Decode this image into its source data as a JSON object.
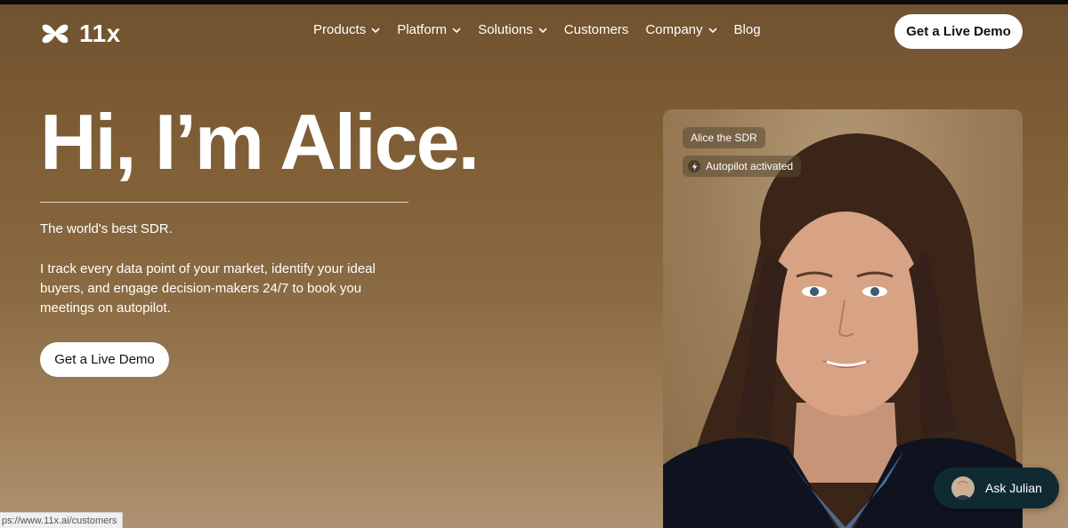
{
  "header": {
    "logo_text": "11x",
    "nav": [
      {
        "label": "Products",
        "has_dropdown": true
      },
      {
        "label": "Platform",
        "has_dropdown": true
      },
      {
        "label": "Solutions",
        "has_dropdown": true
      },
      {
        "label": "Customers",
        "has_dropdown": false
      },
      {
        "label": "Company",
        "has_dropdown": true
      },
      {
        "label": "Blog",
        "has_dropdown": false
      }
    ],
    "cta_label": "Get a Live Demo"
  },
  "hero": {
    "title": "Hi, I’m Alice.",
    "tagline": "The world's best SDR.",
    "description": "I track every data point of your market, identify your ideal buyers, and engage decision-makers 24/7 to book you meetings on autopilot.",
    "cta_label": "Get a Live Demo"
  },
  "card": {
    "name_badge": "Alice the SDR",
    "status_badge": "Autopilot activated",
    "status_icon": "lightning-icon"
  },
  "chat_widget": {
    "label": "Ask Julian",
    "icon": "avatar"
  },
  "status_bar": {
    "url": "ps://www.11x.ai/customers"
  },
  "colors": {
    "background_top": "#6f5230",
    "background_bottom": "#ae9272",
    "chat_widget_bg": "#102a34",
    "button_bg": "#ffffff"
  }
}
